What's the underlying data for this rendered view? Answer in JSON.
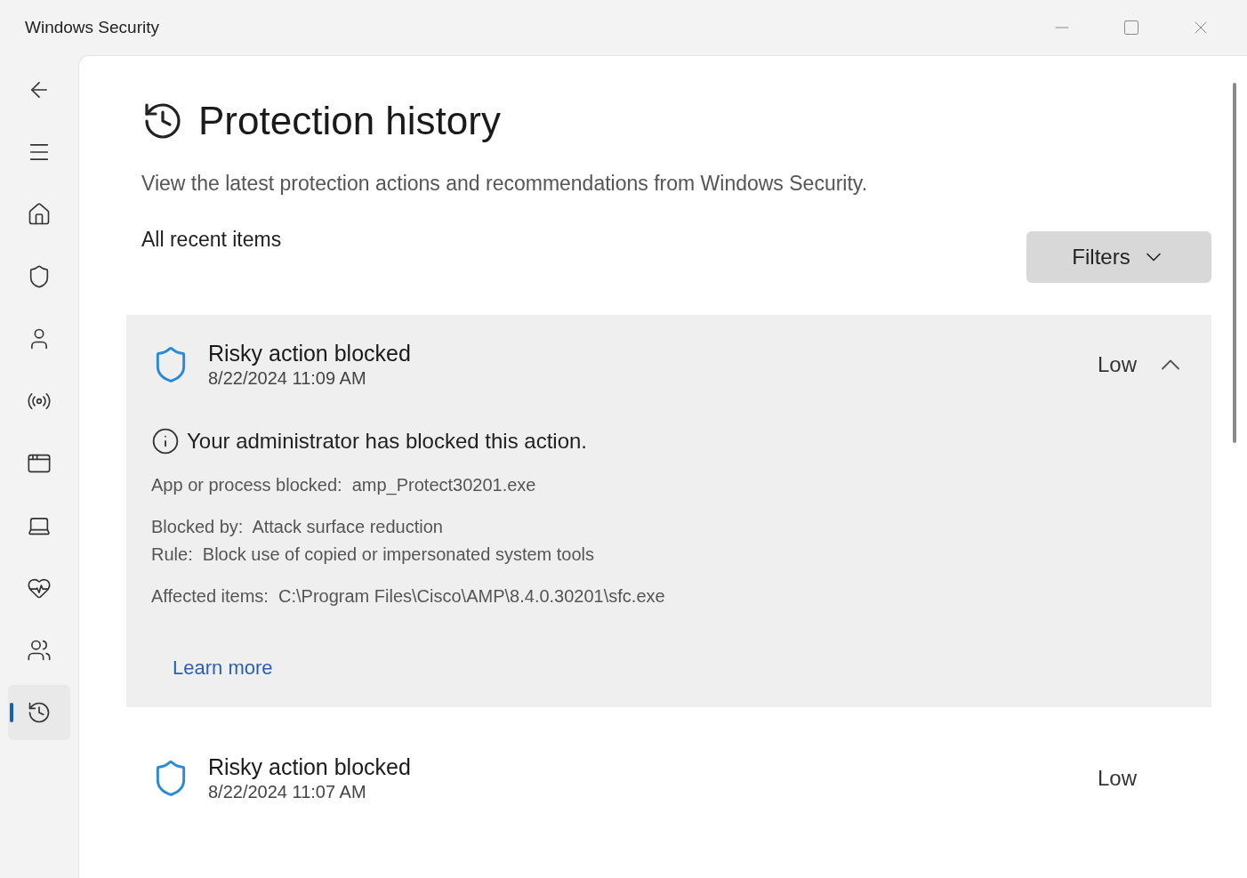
{
  "window": {
    "title": "Windows Security"
  },
  "sidebar": {
    "items": [
      {
        "kind": "back",
        "selected": false
      },
      {
        "kind": "menu",
        "selected": false
      },
      {
        "kind": "home",
        "selected": false
      },
      {
        "kind": "shield",
        "selected": false
      },
      {
        "kind": "account",
        "selected": false
      },
      {
        "kind": "network",
        "selected": false
      },
      {
        "kind": "app",
        "selected": false
      },
      {
        "kind": "device",
        "selected": false
      },
      {
        "kind": "health",
        "selected": false
      },
      {
        "kind": "family",
        "selected": false
      },
      {
        "kind": "history",
        "selected": true
      }
    ]
  },
  "page": {
    "title": "Protection history",
    "description": "View the latest protection actions and recommendations from Windows Security.",
    "section_label": "All recent items",
    "filters_button": "Filters",
    "items": [
      {
        "title": "Risky action blocked",
        "date": "8/22/2024 11:09 AM",
        "severity": "Low",
        "expanded": true,
        "notice": "Your administrator has blocked this action.",
        "detail_groups": [
          [
            "App or process blocked:  amp_Protect30201.exe"
          ],
          [
            "Blocked by:  Attack surface reduction",
            "Rule:  Block use of copied or impersonated system tools"
          ],
          [
            "Affected items:  C:\\Program Files\\Cisco\\AMP\\8.4.0.30201\\sfc.exe"
          ]
        ],
        "link": "Learn more"
      },
      {
        "title": "Risky action blocked",
        "date": "8/22/2024 11:07 AM",
        "severity": "Low",
        "expanded": false
      }
    ]
  }
}
